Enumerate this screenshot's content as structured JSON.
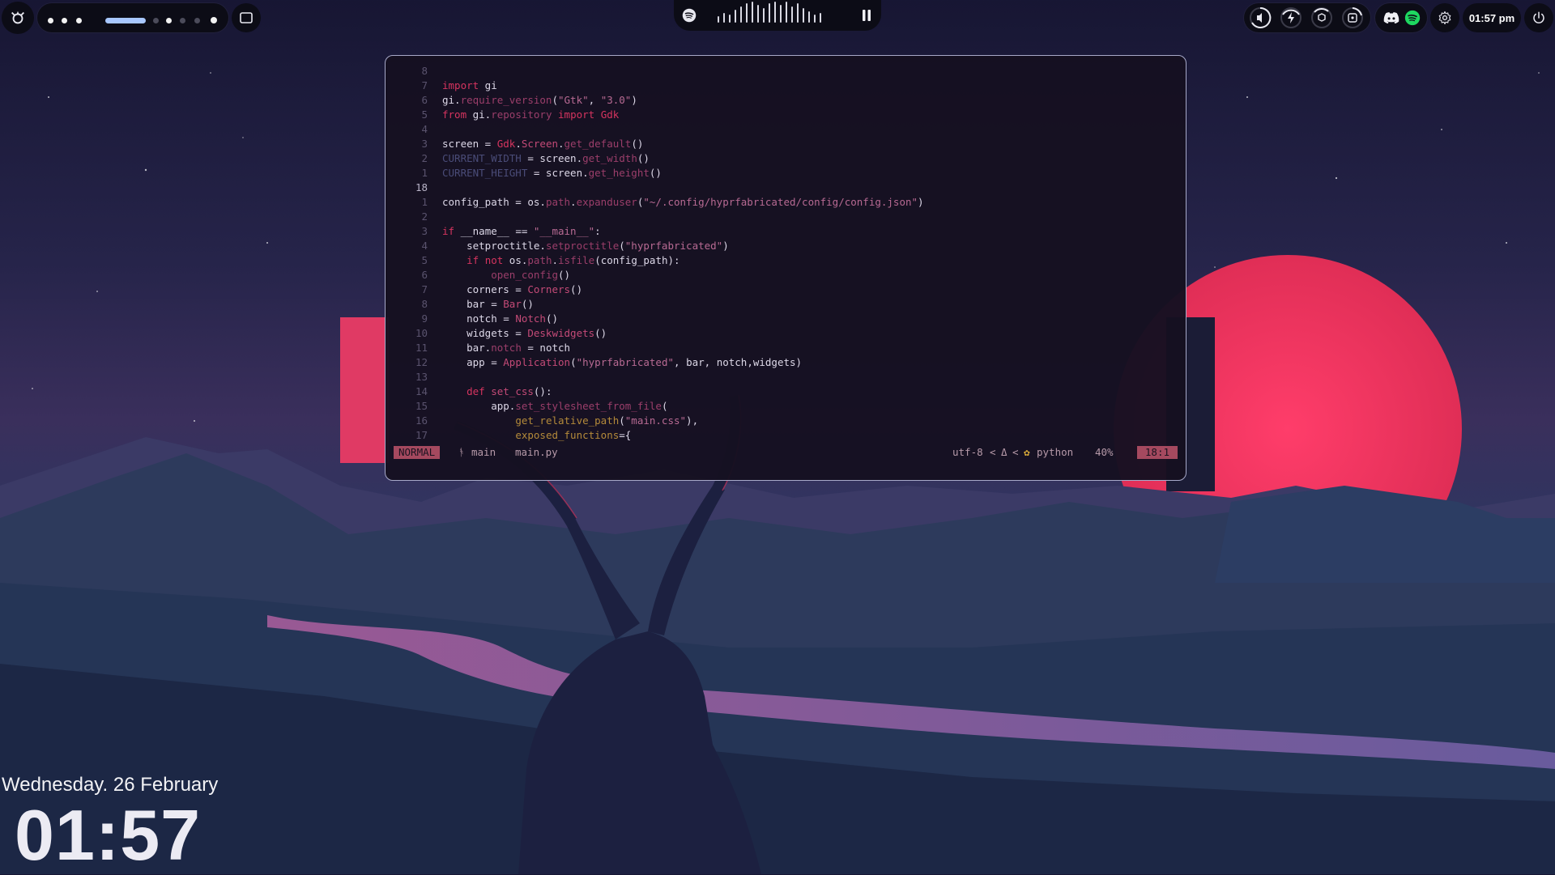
{
  "colors": {
    "bar_bg": "#0c0c16",
    "workspace_active": "#a8c7ff",
    "statusline_accent": "#a5495f",
    "editor_border": "#a7a9c9",
    "spotify_green": "#1ed760"
  },
  "topbar": {
    "launcher_icon": "hyprland-icon",
    "workspaces": [
      {
        "state": "occupied"
      },
      {
        "state": "occupied"
      },
      {
        "state": "occupied"
      },
      {
        "state": "active"
      },
      {
        "state": "occupied"
      },
      {
        "state": "empty"
      },
      {
        "state": "empty"
      },
      {
        "state": "empty"
      },
      {
        "state": "occupied"
      }
    ],
    "overview_icon": "window-icon",
    "media": {
      "app_icon": "spotify-icon",
      "visualizer": "audio-waveform",
      "control_icon": "pause-icon"
    },
    "indicators": [
      "volume-icon",
      "power-profile-icon",
      "cpu-gauge-icon",
      "disk-gauge-icon"
    ],
    "tray": [
      "discord-icon",
      "spotify-icon"
    ],
    "settings_icon": "gear-icon",
    "clock": "01:57 pm",
    "power_icon": "power-icon"
  },
  "editor": {
    "lines": [
      {
        "n": "8",
        "html": ""
      },
      {
        "n": "7",
        "html": "<span class='k'>import</span> gi"
      },
      {
        "n": "6",
        "html": "gi.<span class='m'>require_version</span>(<span class='s'>\"Gtk\"</span>, <span class='s'>\"3.0\"</span>)"
      },
      {
        "n": "5",
        "html": "<span class='k'>from</span> gi.<span class='m'>repository</span> <span class='k'>import</span> <span class='k'>Gdk</span>"
      },
      {
        "n": "4",
        "html": ""
      },
      {
        "n": "3",
        "html": "screen = <span class='k'>Gdk</span>.<span class='f'>Screen</span>.<span class='m'>get_default</span>()"
      },
      {
        "n": "2",
        "html": "<span class='c'>CURRENT_WIDTH</span> = screen.<span class='m'>get_width</span>()"
      },
      {
        "n": "1",
        "html": "<span class='c'>CURRENT_HEIGHT</span> = screen.<span class='m'>get_height</span>()"
      },
      {
        "n": "18",
        "html": "",
        "current": true
      },
      {
        "n": "1",
        "html": "config_path = os.<span class='m'>path</span>.<span class='m'>expanduser</span>(<span class='s'>\"~/.config/hyprfabricated/config/config.json\"</span>)"
      },
      {
        "n": "2",
        "html": ""
      },
      {
        "n": "3",
        "html": "<span class='k'>if</span> __name__ == <span class='s'>\"__main__\"</span>:"
      },
      {
        "n": "4",
        "html": "    setproctitle.<span class='m'>setproctitle</span>(<span class='s'>\"hyprfabricated\"</span>)"
      },
      {
        "n": "5",
        "html": "    <span class='k'>if</span> <span class='k'>not</span> os.<span class='m'>path</span>.<span class='m'>isfile</span>(config_path):"
      },
      {
        "n": "6",
        "html": "        <span class='m'>open_config</span>()"
      },
      {
        "n": "7",
        "html": "    corners = <span class='f'>Corners</span>()"
      },
      {
        "n": "8",
        "html": "    bar = <span class='f'>Bar</span>()"
      },
      {
        "n": "9",
        "html": "    notch = <span class='f'>Notch</span>()"
      },
      {
        "n": "10",
        "html": "    widgets = <span class='f'>Deskwidgets</span>()"
      },
      {
        "n": "11",
        "html": "    bar.<span class='m'>notch</span> = notch"
      },
      {
        "n": "12",
        "html": "    app = <span class='f'>Application</span>(<span class='s'>\"hyprfabricated\"</span>, bar, notch,widgets)"
      },
      {
        "n": "13",
        "html": ""
      },
      {
        "n": "14",
        "html": "    <span class='k'>def</span> <span class='f'>set_css</span>():"
      },
      {
        "n": "15",
        "html": "        app.<span class='m'>set_stylesheet_from_file</span>("
      },
      {
        "n": "16",
        "html": "            <span class='y'>get_relative_path</span>(<span class='s'>\"main.css\"</span>),"
      },
      {
        "n": "17",
        "html": "            <span class='y'>exposed_functions</span>={"
      }
    ],
    "statusline": {
      "mode": "NORMAL",
      "branch_icon": "git-branch-icon",
      "branch": "main",
      "file": "main.py",
      "encoding": "utf-8",
      "diff_icon": "delta-icon",
      "filetype_icon": "python-icon",
      "filetype": "python",
      "percent": "40%",
      "position": "18:1"
    }
  },
  "desktop": {
    "date": "Wednesday. 26 February",
    "time": "01:57"
  }
}
